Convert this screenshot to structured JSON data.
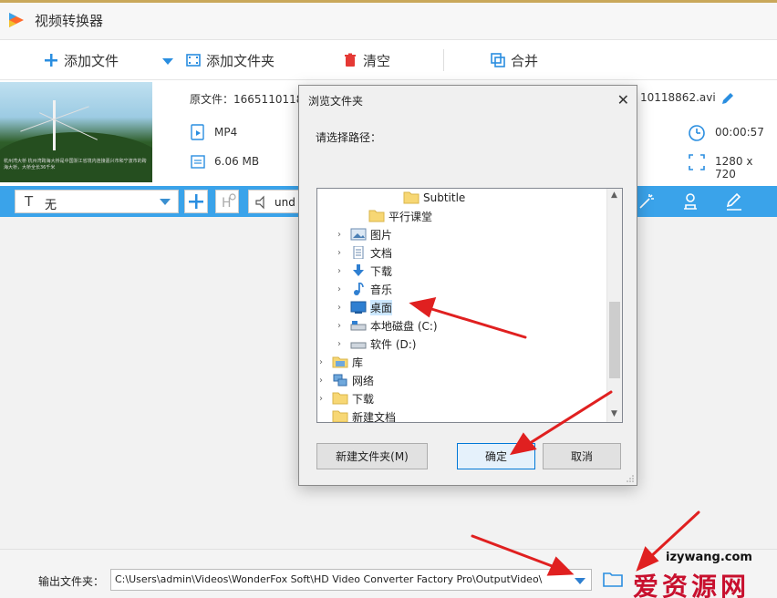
{
  "app": {
    "title": "视频转换器"
  },
  "toolbar": {
    "add_file": "添加文件",
    "add_folder": "添加文件夹",
    "clear": "清空",
    "merge": "合并"
  },
  "file": {
    "source_prefix": "原文件：",
    "source_name": "1665110118",
    "output_name": "10118862.avi",
    "format": "MP4",
    "size": "6.06 MB",
    "duration": "00:00:57",
    "resolution": "1280 x 720",
    "thumb_caption": "杭州湾大桥 杭州湾跨海大桥是中国浙江省境内连接嘉兴市和宁波市的跨海大桥，大桥全长36千米"
  },
  "bluebar": {
    "subtitle_value": "无",
    "audio_label": "und"
  },
  "output": {
    "label": "输出文件夹：",
    "path": "C:\\Users\\admin\\Videos\\WonderFox Soft\\HD Video Converter Factory Pro\\OutputVideo\\"
  },
  "dialog": {
    "title": "浏览文件夹",
    "prompt": "请选择路径：",
    "tree": [
      {
        "label": "Subtitle",
        "icon": "folder-icon"
      },
      {
        "label": "平行课堂",
        "icon": "folder-icon"
      },
      {
        "label": "图片",
        "icon": "pictures-icon"
      },
      {
        "label": "文档",
        "icon": "documents-icon"
      },
      {
        "label": "下载",
        "icon": "download-icon"
      },
      {
        "label": "音乐",
        "icon": "music-icon"
      },
      {
        "label": "桌面",
        "icon": "desktop-icon"
      },
      {
        "label": "本地磁盘 (C:)",
        "icon": "drive-icon"
      },
      {
        "label": "软件 (D:)",
        "icon": "drive-icon"
      },
      {
        "label": "库",
        "icon": "library-icon"
      },
      {
        "label": "网络",
        "icon": "network-icon"
      },
      {
        "label": "下载",
        "icon": "folder-icon"
      },
      {
        "label": "新建文档",
        "icon": "folder-icon"
      }
    ],
    "new_folder_button": "新建文件夹(M)",
    "ok_button": "确定",
    "cancel_button": "取消"
  },
  "watermark": {
    "domain": "izywang.com",
    "text": "爱资源网"
  },
  "colors": {
    "accent_blue": "#3aa3ea",
    "annotation_red": "#e02020"
  }
}
